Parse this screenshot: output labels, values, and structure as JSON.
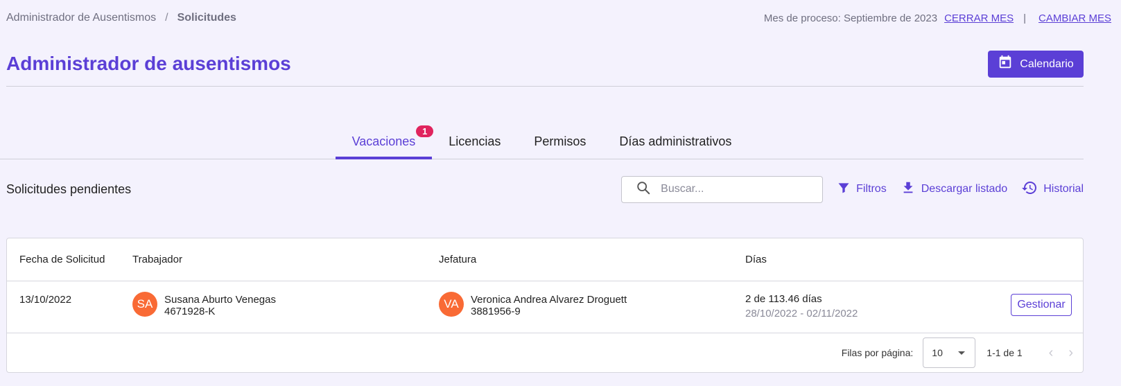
{
  "breadcrumb": {
    "parent": "Administrador de Ausentismos",
    "separator": "/",
    "current": "Solicitudes"
  },
  "process": {
    "label": "Mes de proceso: Septiembre de 2023",
    "close_month": "CERRAR MES",
    "divider": "|",
    "change_month": "CAMBIAR MES"
  },
  "page": {
    "title": "Administrador de ausentismos",
    "calendar_button": "Calendario"
  },
  "tabs": [
    {
      "label": "Vacaciones",
      "badge": "1",
      "active": true
    },
    {
      "label": "Licencias"
    },
    {
      "label": "Permisos"
    },
    {
      "label": "Días administrativos"
    }
  ],
  "toolbar": {
    "section_title": "Solicitudes pendientes",
    "search_placeholder": "Buscar...",
    "filters": "Filtros",
    "download": "Descargar listado",
    "history": "Historial"
  },
  "table": {
    "headers": {
      "fecha": "Fecha de Solicitud",
      "trabajador": "Trabajador",
      "jefatura": "Jefatura",
      "dias": "Días"
    },
    "rows": [
      {
        "fecha": "13/10/2022",
        "trabajador": {
          "initials": "SA",
          "name": "Susana Aburto Venegas",
          "id": "4671928-K"
        },
        "jefatura": {
          "initials": "VA",
          "name": "Veronica Andrea Alvarez Droguett",
          "id": "3881956-9"
        },
        "dias": "2 de 113.46 días",
        "rango": "28/10/2022 - 02/11/2022",
        "action": "Gestionar"
      }
    ]
  },
  "pagination": {
    "rows_label": "Filas por página:",
    "rows_value": "10",
    "range": "1-1 de 1"
  },
  "colors": {
    "accent": "#5b3fd6",
    "badge": "#e0245e",
    "avatar": "#f96a35",
    "background": "#f4f2fd"
  }
}
